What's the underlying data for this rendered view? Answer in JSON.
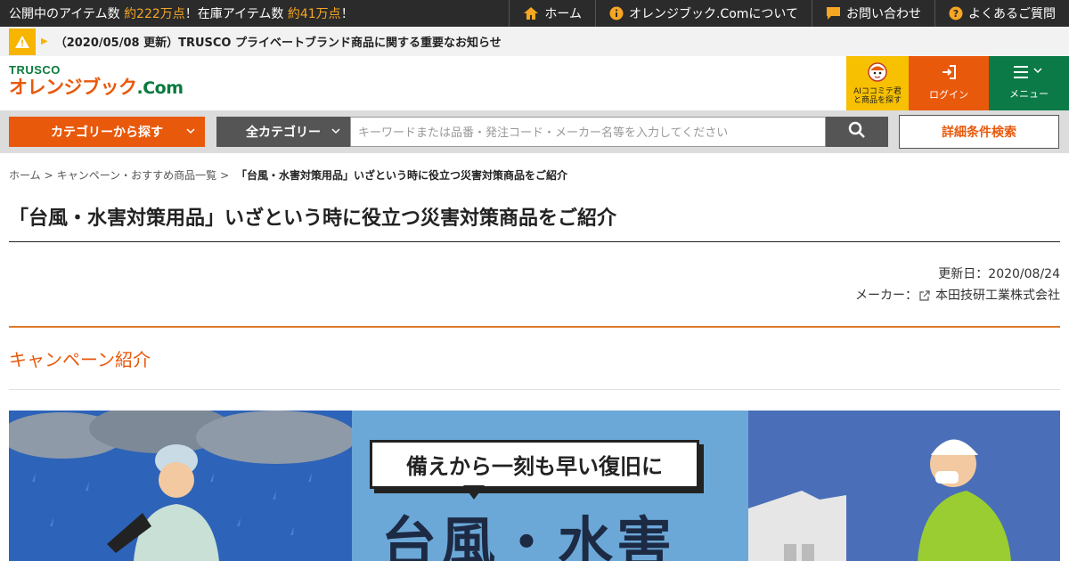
{
  "topbar": {
    "stock_prefix": "公開中のアイテム数",
    "stock_count": "約222万点",
    "stock_mid": "！在庫アイテム数",
    "stock_instock": "約41万点",
    "stock_suffix": "！",
    "links": [
      {
        "label": "ホーム",
        "icon": "home-icon"
      },
      {
        "label": "オレンジブック.Comについて",
        "icon": "info-icon"
      },
      {
        "label": "お問い合わせ",
        "icon": "chat-icon"
      },
      {
        "label": "よくあるご質問",
        "icon": "question-icon"
      }
    ]
  },
  "notice": {
    "text": "（2020/05/08 更新）TRUSCO プライベートブランド商品に関する重要なお知らせ"
  },
  "header": {
    "logo_brand": "TRUSCO",
    "logo_name": "オレンジブック",
    "logo_com": ".Com",
    "ai_label": "AIココミテ君と商品を探す",
    "login_label": "ログイン",
    "menu_label": "メニュー"
  },
  "search": {
    "category_button": "カテゴリーから探す",
    "all_category": "全カテゴリー",
    "placeholder": "キーワードまたは品番・発注コード・メーカー名等を入力してください",
    "detail_button": "詳細条件検索"
  },
  "breadcrumb": [
    "ホーム",
    "キャンペーン・おすすめ商品一覧",
    "「台風・水害対策用品」いざという時に役立つ災害対策商品をご紹介"
  ],
  "page": {
    "title": "「台風・水害対策用品」いざという時に役立つ災害対策商品をご紹介",
    "updated": "更新日：2020/08/24",
    "maker_label": "メーカー：",
    "maker_name": "本田技研工業株式会社",
    "section_title": "キャンペーン紹介"
  },
  "banner": {
    "bubble": "備えから一刻も早い復旧に",
    "headline": "台風・水害"
  },
  "colors": {
    "accent": "#e8590c",
    "green": "#0b7a47",
    "yellow": "#f7c000",
    "dark": "#2b2b2b"
  }
}
